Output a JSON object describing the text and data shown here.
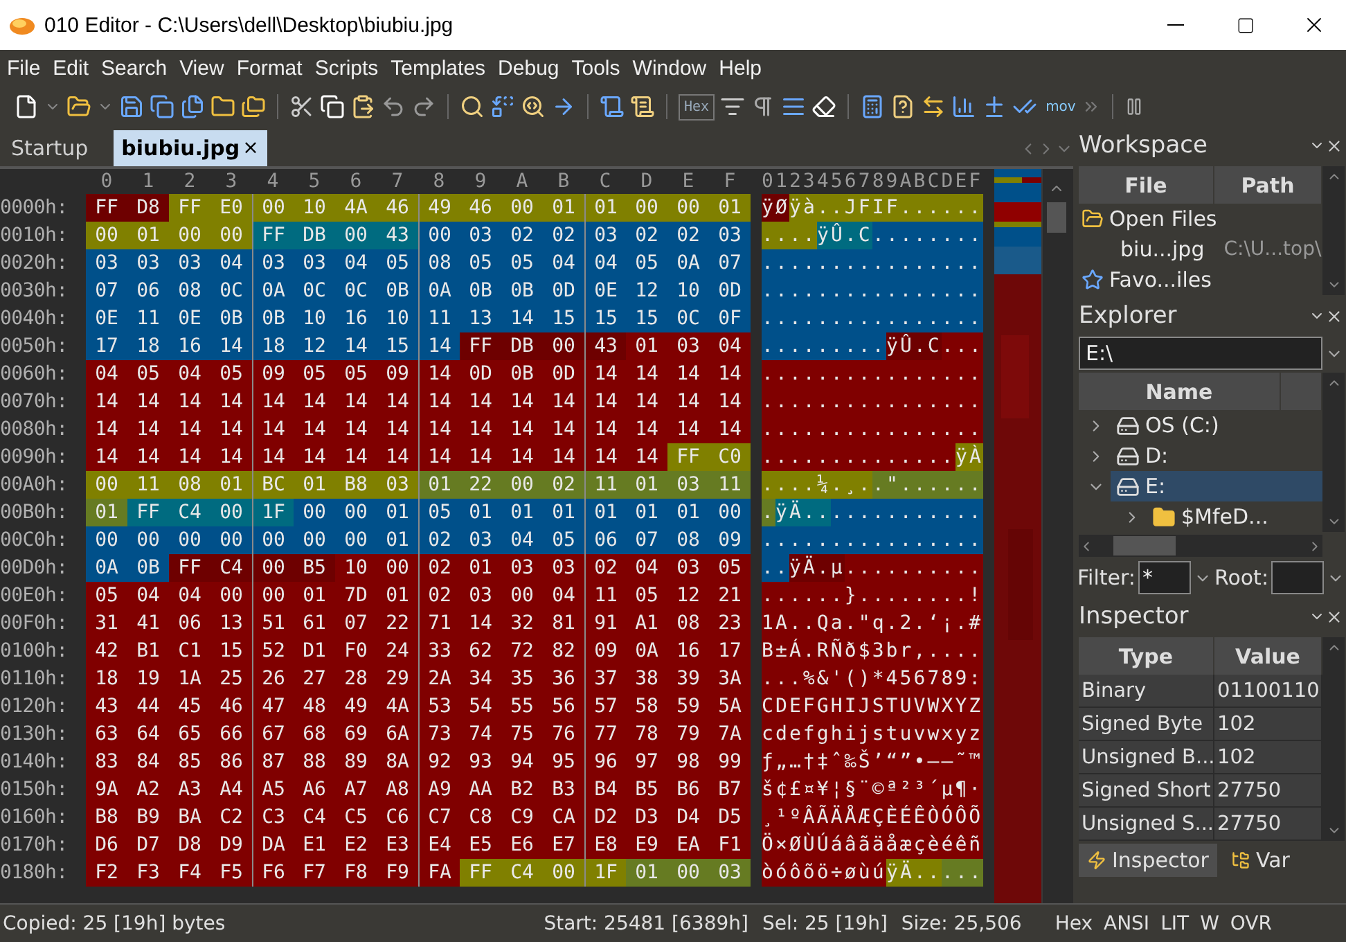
{
  "window": {
    "title": "010 Editor - C:\\Users\\dell\\Desktop\\biubiu.jpg"
  },
  "menu": [
    "File",
    "Edit",
    "Search",
    "View",
    "Format",
    "Scripts",
    "Templates",
    "Debug",
    "Tools",
    "Window",
    "Help"
  ],
  "toolbar": {
    "hex_label": "Hex",
    "mov_label": "mov"
  },
  "tabs": [
    {
      "label": "Startup",
      "selected": false
    },
    {
      "label": "biubiu.jpg",
      "selected": true,
      "close": "×"
    }
  ],
  "hex_view": {
    "columns": [
      "0",
      "1",
      "2",
      "3",
      "4",
      "5",
      "6",
      "7",
      "8",
      "9",
      "A",
      "B",
      "C",
      "D",
      "E",
      "F"
    ],
    "ascii_header": "0123456789ABCDEF",
    "rows": [
      {
        "offset": "0000h:",
        "segments": [
          {
            "color": "#6e0000",
            "bytes": [
              "FF",
              "D8"
            ],
            "ascii": "ÿØ"
          },
          {
            "color": "#808000",
            "bytes": [
              "FF",
              "E0",
              "00",
              "10",
              "4A",
              "46",
              "49",
              "46",
              "00",
              "01",
              "01",
              "00",
              "00",
              "01"
            ],
            "ascii": "ÿà..JFIF......"
          }
        ]
      },
      {
        "offset": "0010h:",
        "segments": [
          {
            "color": "#808000",
            "bytes": [
              "00",
              "01",
              "00",
              "00"
            ],
            "ascii": "...."
          },
          {
            "color": "#006b80",
            "bytes": [
              "FF",
              "DB",
              "00",
              "43"
            ],
            "ascii": "ÿÛ.C"
          },
          {
            "color": "#00508a",
            "bytes": [
              "00",
              "03",
              "02",
              "02",
              "03",
              "02",
              "02",
              "03"
            ],
            "ascii": "........"
          }
        ]
      },
      {
        "offset": "0020h:",
        "segments": [
          {
            "color": "#00508a",
            "bytes": [
              "03",
              "03",
              "03",
              "04",
              "03",
              "03",
              "04",
              "05",
              "08",
              "05",
              "05",
              "04",
              "04",
              "05",
              "0A",
              "07"
            ],
            "ascii": "................"
          }
        ]
      },
      {
        "offset": "0030h:",
        "segments": [
          {
            "color": "#00508a",
            "bytes": [
              "07",
              "06",
              "08",
              "0C",
              "0A",
              "0C",
              "0C",
              "0B",
              "0A",
              "0B",
              "0B",
              "0D",
              "0E",
              "12",
              "10",
              "0D"
            ],
            "ascii": "................"
          }
        ]
      },
      {
        "offset": "0040h:",
        "segments": [
          {
            "color": "#00508a",
            "bytes": [
              "0E",
              "11",
              "0E",
              "0B",
              "0B",
              "10",
              "16",
              "10",
              "11",
              "13",
              "14",
              "15",
              "15",
              "15",
              "0C",
              "0F"
            ],
            "ascii": "................"
          }
        ]
      },
      {
        "offset": "0050h:",
        "segments": [
          {
            "color": "#00508a",
            "bytes": [
              "17",
              "18",
              "16",
              "14",
              "18",
              "12",
              "14",
              "15",
              "14"
            ],
            "ascii": "........."
          },
          {
            "color": "#6e0000",
            "bytes": [
              "FF",
              "DB",
              "00",
              "43"
            ],
            "ascii": "ÿÛ.C"
          },
          {
            "color": "#800000",
            "bytes": [
              "01",
              "03",
              "04"
            ],
            "ascii": "..."
          }
        ]
      },
      {
        "offset": "0060h:",
        "segments": [
          {
            "color": "#800000",
            "bytes": [
              "04",
              "05",
              "04",
              "05",
              "09",
              "05",
              "05",
              "09",
              "14",
              "0D",
              "0B",
              "0D",
              "14",
              "14",
              "14",
              "14"
            ],
            "ascii": "................"
          }
        ]
      },
      {
        "offset": "0070h:",
        "segments": [
          {
            "color": "#800000",
            "bytes": [
              "14",
              "14",
              "14",
              "14",
              "14",
              "14",
              "14",
              "14",
              "14",
              "14",
              "14",
              "14",
              "14",
              "14",
              "14",
              "14"
            ],
            "ascii": "................"
          }
        ]
      },
      {
        "offset": "0080h:",
        "segments": [
          {
            "color": "#800000",
            "bytes": [
              "14",
              "14",
              "14",
              "14",
              "14",
              "14",
              "14",
              "14",
              "14",
              "14",
              "14",
              "14",
              "14",
              "14",
              "14",
              "14"
            ],
            "ascii": "................"
          }
        ]
      },
      {
        "offset": "0090h:",
        "segments": [
          {
            "color": "#800000",
            "bytes": [
              "14",
              "14",
              "14",
              "14",
              "14",
              "14",
              "14",
              "14",
              "14",
              "14",
              "14",
              "14",
              "14",
              "14"
            ],
            "ascii": ".............."
          },
          {
            "color": "#808000",
            "bytes": [
              "FF",
              "C0"
            ],
            "ascii": "ÿÀ"
          }
        ]
      },
      {
        "offset": "00A0h:",
        "segments": [
          {
            "color": "#808000",
            "bytes": [
              "00",
              "11",
              "08",
              "01",
              "BC",
              "01",
              "B8",
              "03"
            ],
            "ascii": "....¼.¸."
          },
          {
            "color": "#667b22",
            "bytes": [
              "01",
              "22",
              "00",
              "02",
              "11",
              "01",
              "03",
              "11"
            ],
            "ascii": ".\"......"
          }
        ]
      },
      {
        "offset": "00B0h:",
        "segments": [
          {
            "color": "#667b22",
            "bytes": [
              "01"
            ],
            "ascii": "."
          },
          {
            "color": "#006b80",
            "bytes": [
              "FF",
              "C4",
              "00",
              "1F"
            ],
            "ascii": "ÿÄ.."
          },
          {
            "color": "#00508a",
            "bytes": [
              "00",
              "00",
              "01",
              "05",
              "01",
              "01",
              "01",
              "01",
              "01",
              "01",
              "00"
            ],
            "ascii": "..........."
          }
        ]
      },
      {
        "offset": "00C0h:",
        "segments": [
          {
            "color": "#00508a",
            "bytes": [
              "00",
              "00",
              "00",
              "00",
              "00",
              "00",
              "00",
              "01",
              "02",
              "03",
              "04",
              "05",
              "06",
              "07",
              "08",
              "09"
            ],
            "ascii": "................"
          }
        ]
      },
      {
        "offset": "00D0h:",
        "segments": [
          {
            "color": "#00508a",
            "bytes": [
              "0A",
              "0B"
            ],
            "ascii": ".."
          },
          {
            "color": "#6e0000",
            "bytes": [
              "FF",
              "C4",
              "00",
              "B5"
            ],
            "ascii": "ÿÄ.µ"
          },
          {
            "color": "#800000",
            "bytes": [
              "10",
              "00",
              "02",
              "01",
              "03",
              "03",
              "02",
              "04",
              "03",
              "05"
            ],
            "ascii": ".........."
          }
        ]
      },
      {
        "offset": "00E0h:",
        "segments": [
          {
            "color": "#800000",
            "bytes": [
              "05",
              "04",
              "04",
              "00",
              "00",
              "01",
              "7D",
              "01",
              "02",
              "03",
              "00",
              "04",
              "11",
              "05",
              "12",
              "21"
            ],
            "ascii": "......}........!"
          }
        ]
      },
      {
        "offset": "00F0h:",
        "segments": [
          {
            "color": "#800000",
            "bytes": [
              "31",
              "41",
              "06",
              "13",
              "51",
              "61",
              "07",
              "22",
              "71",
              "14",
              "32",
              "81",
              "91",
              "A1",
              "08",
              "23"
            ],
            "ascii": "1A..Qa.\"q.2.‘¡.#"
          }
        ]
      },
      {
        "offset": "0100h:",
        "segments": [
          {
            "color": "#800000",
            "bytes": [
              "42",
              "B1",
              "C1",
              "15",
              "52",
              "D1",
              "F0",
              "24",
              "33",
              "62",
              "72",
              "82",
              "09",
              "0A",
              "16",
              "17"
            ],
            "ascii": "B±Á.RÑð$3br‚...."
          }
        ]
      },
      {
        "offset": "0110h:",
        "segments": [
          {
            "color": "#800000",
            "bytes": [
              "18",
              "19",
              "1A",
              "25",
              "26",
              "27",
              "28",
              "29",
              "2A",
              "34",
              "35",
              "36",
              "37",
              "38",
              "39",
              "3A"
            ],
            "ascii": "...%&'()*456789:"
          }
        ]
      },
      {
        "offset": "0120h:",
        "segments": [
          {
            "color": "#800000",
            "bytes": [
              "43",
              "44",
              "45",
              "46",
              "47",
              "48",
              "49",
              "4A",
              "53",
              "54",
              "55",
              "56",
              "57",
              "58",
              "59",
              "5A"
            ],
            "ascii": "CDEFGHIJSTUVWXYZ"
          }
        ]
      },
      {
        "offset": "0130h:",
        "segments": [
          {
            "color": "#800000",
            "bytes": [
              "63",
              "64",
              "65",
              "66",
              "67",
              "68",
              "69",
              "6A",
              "73",
              "74",
              "75",
              "76",
              "77",
              "78",
              "79",
              "7A"
            ],
            "ascii": "cdefghijstuvwxyz"
          }
        ]
      },
      {
        "offset": "0140h:",
        "segments": [
          {
            "color": "#800000",
            "bytes": [
              "83",
              "84",
              "85",
              "86",
              "87",
              "88",
              "89",
              "8A",
              "92",
              "93",
              "94",
              "95",
              "96",
              "97",
              "98",
              "99"
            ],
            "ascii": "ƒ„…†‡ˆ‰Š’“”•–—˜™"
          }
        ]
      },
      {
        "offset": "0150h:",
        "segments": [
          {
            "color": "#800000",
            "bytes": [
              "9A",
              "A2",
              "A3",
              "A4",
              "A5",
              "A6",
              "A7",
              "A8",
              "A9",
              "AA",
              "B2",
              "B3",
              "B4",
              "B5",
              "B6",
              "B7"
            ],
            "ascii": "š¢£¤¥¦§¨©ª²³´µ¶·"
          }
        ]
      },
      {
        "offset": "0160h:",
        "segments": [
          {
            "color": "#800000",
            "bytes": [
              "B8",
              "B9",
              "BA",
              "C2",
              "C3",
              "C4",
              "C5",
              "C6",
              "C7",
              "C8",
              "C9",
              "CA",
              "D2",
              "D3",
              "D4",
              "D5"
            ],
            "ascii": "¸¹ºÂÃÄÅÆÇÈÉÊÒÓÔÕ"
          }
        ]
      },
      {
        "offset": "0170h:",
        "segments": [
          {
            "color": "#800000",
            "bytes": [
              "D6",
              "D7",
              "D8",
              "D9",
              "DA",
              "E1",
              "E2",
              "E3",
              "E4",
              "E5",
              "E6",
              "E7",
              "E8",
              "E9",
              "EA",
              "F1"
            ],
            "ascii": "Ö×ØÙÚáâãäåæçèéêñ"
          }
        ]
      },
      {
        "offset": "0180h:",
        "segments": [
          {
            "color": "#800000",
            "bytes": [
              "F2",
              "F3",
              "F4",
              "F5",
              "F6",
              "F7",
              "F8",
              "F9",
              "FA"
            ],
            "ascii": "òóôõö÷øùú"
          },
          {
            "color": "#808000",
            "bytes": [
              "FF",
              "C4",
              "00",
              "1F"
            ],
            "ascii": "ÿÄ.."
          },
          {
            "color": "#667b22",
            "bytes": [
              "01",
              "00",
              "03"
            ],
            "ascii": "..."
          }
        ]
      }
    ]
  },
  "workspace": {
    "title": "Workspace",
    "columns": [
      "File",
      "Path"
    ],
    "items": [
      {
        "label": "Open Files",
        "expanded": true,
        "children": [
          {
            "label": "biu...jpg",
            "path": "C:\\U...top\\"
          }
        ]
      },
      {
        "label": "Favo...iles",
        "expanded": false
      }
    ]
  },
  "explorer": {
    "title": "Explorer",
    "path": "E:\\",
    "columns": [
      "Name"
    ],
    "items": [
      {
        "label": "OS (C:)",
        "kind": "drive",
        "expanded": false,
        "selected": false
      },
      {
        "label": "D:",
        "kind": "drive",
        "expanded": false,
        "selected": false
      },
      {
        "label": "E:",
        "kind": "drive",
        "expanded": true,
        "selected": true,
        "children": [
          {
            "label": "$MfeD...",
            "kind": "folder",
            "expanded": false,
            "selected": false
          }
        ]
      }
    ],
    "filter_label": "Filter:",
    "filter": "*",
    "root_label": "Root:"
  },
  "inspector": {
    "title": "Inspector",
    "columns": [
      "Type",
      "Value"
    ],
    "rows": [
      {
        "type": "Binary",
        "value": "01100110"
      },
      {
        "type": "Signed Byte",
        "value": "102"
      },
      {
        "type": "Unsigned B...",
        "value": "102"
      },
      {
        "type": "Signed Short",
        "value": "27750"
      },
      {
        "type": "Unsigned S...",
        "value": "27750"
      }
    ]
  },
  "bottom_tabs": [
    {
      "label": "Inspector",
      "selected": true
    },
    {
      "label": "Var",
      "selected": false
    }
  ],
  "status_bar": {
    "message": "Copied: 25 [19h] bytes",
    "start": "Start: 25481 [6389h]",
    "sel": "Sel: 25 [19h]",
    "size": "Size: 25,506",
    "modes": [
      "Hex",
      "ANSI",
      "LIT",
      "W",
      "OVR"
    ]
  }
}
